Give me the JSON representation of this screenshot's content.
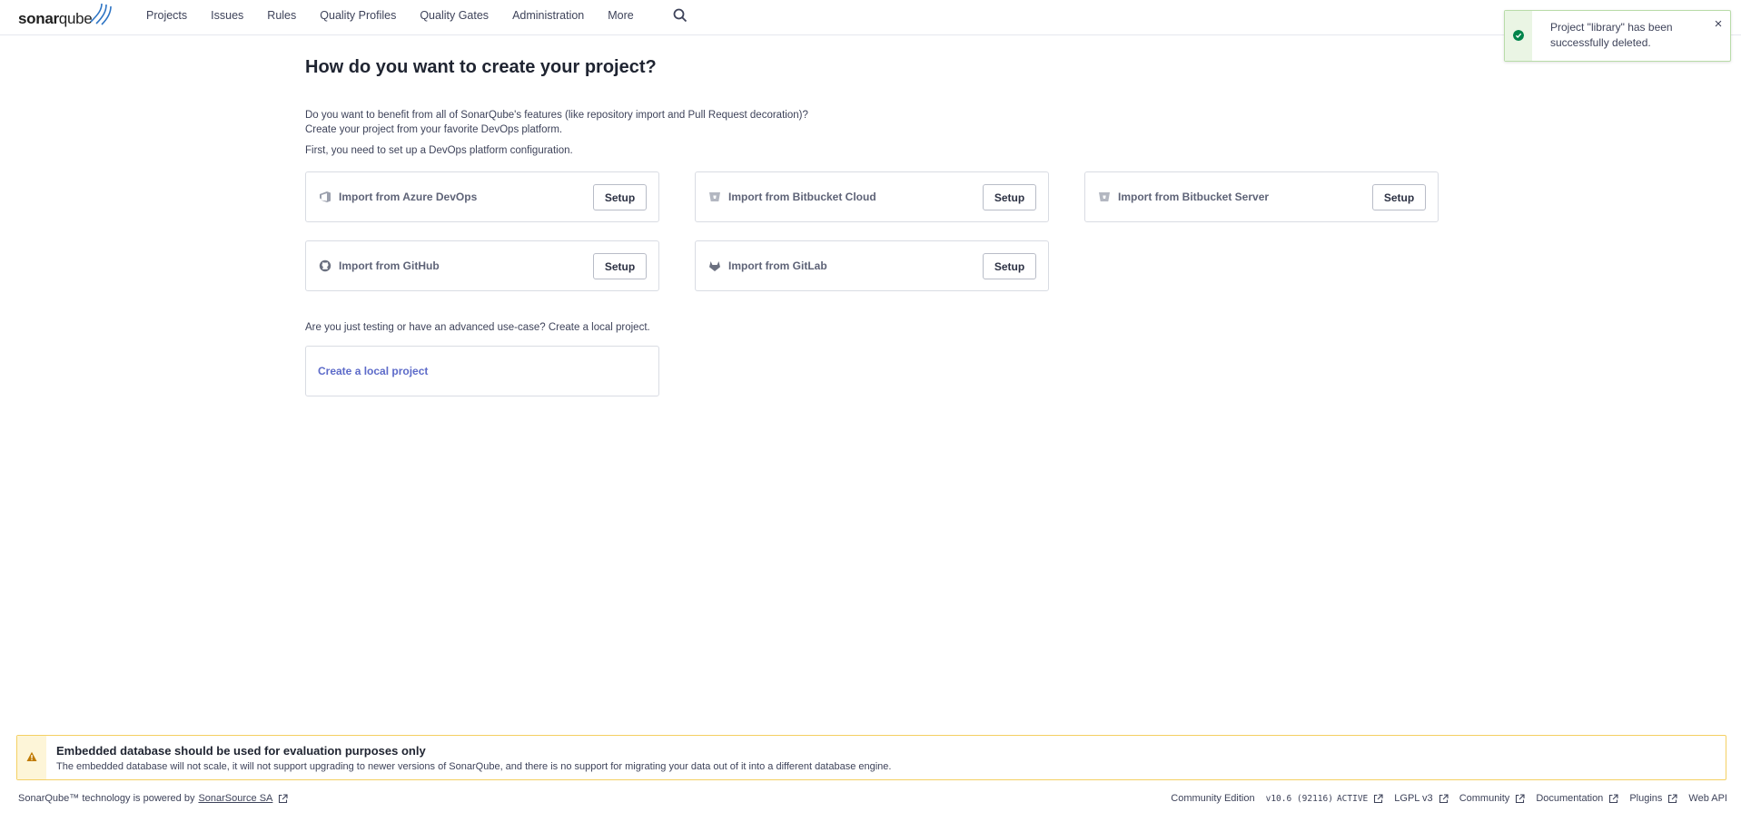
{
  "nav": {
    "logo_bold": "sonar",
    "logo_light": "qube",
    "items": [
      {
        "label": "Projects"
      },
      {
        "label": "Issues"
      },
      {
        "label": "Rules"
      },
      {
        "label": "Quality Profiles"
      },
      {
        "label": "Quality Gates"
      },
      {
        "label": "Administration"
      },
      {
        "label": "More"
      }
    ],
    "search_icon": "search-icon"
  },
  "toast": {
    "message": "Project \"library\" has been successfully deleted.",
    "close_label": "×",
    "status_color": "#00844a"
  },
  "main": {
    "title": "How do you want to create your project?",
    "intro_line1": "Do you want to benefit from all of SonarQube's features (like repository import and Pull Request decoration)?",
    "intro_line2": "Create your project from your favorite DevOps platform.",
    "intro_line3": "First, you need to set up a DevOps platform configuration.",
    "platforms": [
      {
        "label": "Import from Azure DevOps",
        "button": "Setup",
        "icon": "azure-devops-icon"
      },
      {
        "label": "Import from Bitbucket Cloud",
        "button": "Setup",
        "icon": "bitbucket-icon"
      },
      {
        "label": "Import from Bitbucket Server",
        "button": "Setup",
        "icon": "bitbucket-icon"
      },
      {
        "label": "Import from GitHub",
        "button": "Setup",
        "icon": "github-icon"
      },
      {
        "label": "Import from GitLab",
        "button": "Setup",
        "icon": "gitlab-icon"
      }
    ],
    "local_question": "Are you just testing or have an advanced use-case? Create a local project.",
    "local_link": "Create a local project"
  },
  "warning": {
    "title": "Embedded database should be used for evaluation purposes only",
    "body": "The embedded database will not scale, it will not support upgrading to newer versions of SonarQube, and there is no support for migrating your data out of it into a different database engine.",
    "color": "#f4d063"
  },
  "footer": {
    "powered_text": "SonarQube™ technology is powered by",
    "powered_link": "SonarSource SA",
    "edition": "Community Edition",
    "version": "v10.6 (92116)",
    "status": "ACTIVE",
    "license": "LGPL v3",
    "community": "Community",
    "documentation": "Documentation",
    "plugins": "Plugins",
    "web_api": "Web API"
  },
  "colors": {
    "link": "#5d6bc9",
    "text": "#3e435a"
  }
}
